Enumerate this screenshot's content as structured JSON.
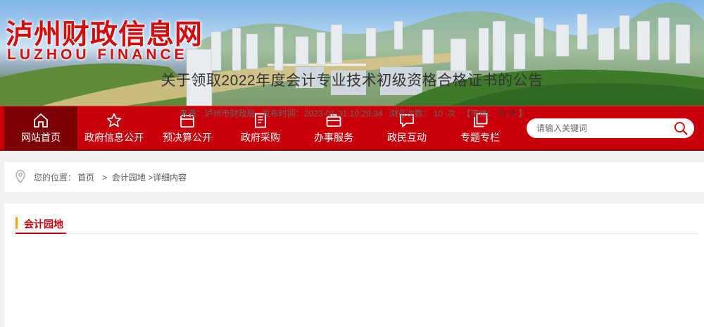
{
  "banner": {
    "title": "泸州财政信息网",
    "subtitle": "LUZHOU FINANCE"
  },
  "nav": {
    "items": [
      {
        "label": "网站首页",
        "icon": "home-icon"
      },
      {
        "label": "政府信息公开",
        "icon": "star-icon"
      },
      {
        "label": "预决算公开",
        "icon": "calendar-icon"
      },
      {
        "label": "政府采购",
        "icon": "document-icon"
      },
      {
        "label": "办事服务",
        "icon": "briefcase-icon"
      },
      {
        "label": "政民互动",
        "icon": "chat-icon"
      },
      {
        "label": "专题专栏",
        "icon": "layers-icon"
      }
    ],
    "active_index": 0,
    "search_placeholder": "请输入关键词"
  },
  "breadcrumb": {
    "label": "您的位置：",
    "home": "首页",
    "section": "会计园地",
    "current": "详细内容",
    "sep": ">"
  },
  "section": {
    "title": "会计园地"
  },
  "article": {
    "title": "关于领取2022年度会计专业技术初级资格合格证书的公告",
    "source_label": "来源：",
    "source": "泸州市财政局",
    "date_label": "发布时间：",
    "date": "2023-01-31 10:29:34",
    "views_label": "浏览次数：",
    "views": "10",
    "views_unit": "次",
    "font_label": "【字体：",
    "font_small": "小",
    "font_large": "大",
    "font_close": "】"
  },
  "colors": {
    "nav_red": "#c8000b",
    "nav_active": "#7d0006",
    "accent_orange": "#f5a500",
    "title_red": "#d30b0b"
  }
}
